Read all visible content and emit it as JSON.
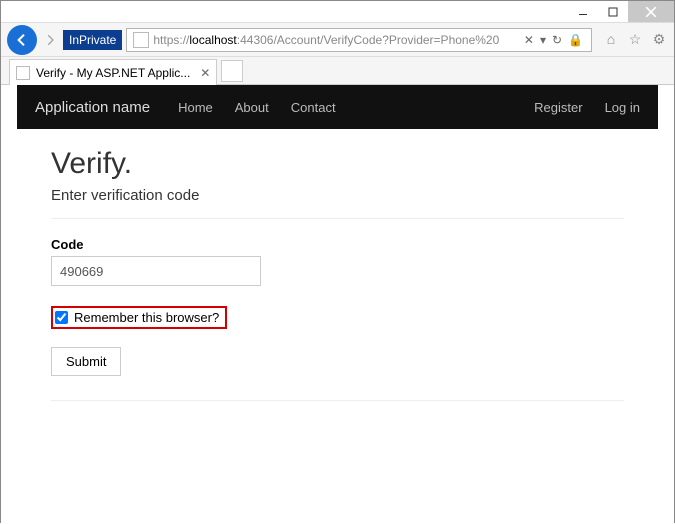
{
  "window": {
    "inprivate_label": "InPrivate",
    "url_prefix": "https://",
    "url_host": "localhost",
    "url_rest": ":44306/Account/VerifyCode?Provider=Phone%20",
    "tab_title": "Verify - My ASP.NET Applic..."
  },
  "navbar": {
    "brand": "Application name",
    "links": [
      "Home",
      "About",
      "Contact"
    ],
    "right": [
      "Register",
      "Log in"
    ]
  },
  "form": {
    "heading": "Verify.",
    "subheading": "Enter verification code",
    "code_label": "Code",
    "code_value": "490669",
    "remember_label": "Remember this browser?",
    "remember_checked": true,
    "submit_label": "Submit"
  }
}
